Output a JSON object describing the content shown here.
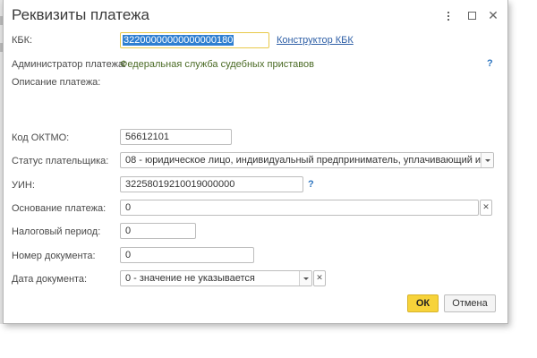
{
  "window": {
    "title": "Реквизиты платежа",
    "menu_icon": "more-vertical-icon",
    "maximize_icon": "maximize-icon",
    "close_icon": "close-icon"
  },
  "form": {
    "kbk": {
      "label": "КБК:",
      "value": "32200000000000000180",
      "link": "Конструктор КБК"
    },
    "admin": {
      "label": "Администратор платежа:",
      "value": "Федеральная служба судебных приставов",
      "help": "?"
    },
    "description": {
      "label": "Описание платежа:",
      "value": ""
    },
    "oktmo": {
      "label": "Код ОКТМО:",
      "value": "56612101"
    },
    "status": {
      "label": "Статус плательщика:",
      "value": "08 - юридическое лицо, индивидуальный предприниматель, уплачивающий иные п"
    },
    "uin": {
      "label": "УИН:",
      "value": "32258019210019000000",
      "help": "?"
    },
    "basis": {
      "label": "Основание платежа:",
      "value": "0"
    },
    "tax_period": {
      "label": "Налоговый период:",
      "value": "0"
    },
    "doc_number": {
      "label": "Номер документа:",
      "value": "0"
    },
    "doc_date": {
      "label": "Дата документа:",
      "value": "0 - значение не указывается"
    }
  },
  "buttons": {
    "ok": "ОК",
    "cancel": "Отмена"
  },
  "colors": {
    "ok_button": "#f7d33a",
    "link": "#2e5fa6",
    "help": "#2e76c0",
    "selection": "#2f7fd1"
  }
}
